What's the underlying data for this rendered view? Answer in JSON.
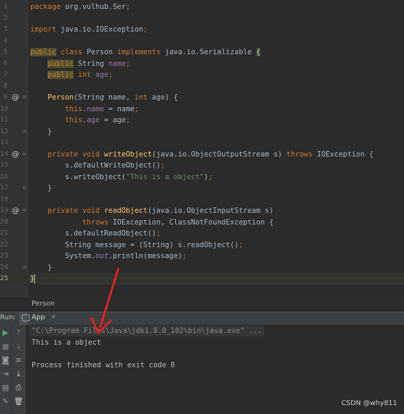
{
  "editor": {
    "lines": [
      {
        "n": "1",
        "ann": "",
        "fold": "",
        "tokens": [
          {
            "t": "package ",
            "c": "#cc7832"
          },
          {
            "t": "org.vulhub.Ser",
            "c": "#a9b7c6"
          },
          {
            "t": ";",
            "c": "#cc7832"
          }
        ]
      },
      {
        "n": "2",
        "ann": "",
        "fold": "",
        "tokens": []
      },
      {
        "n": "3",
        "ann": "",
        "fold": "",
        "tokens": [
          {
            "t": "import ",
            "c": "#cc7832"
          },
          {
            "t": "java.io.IOException",
            "c": "#a9b7c6"
          },
          {
            "t": ";",
            "c": "#cc7832"
          }
        ]
      },
      {
        "n": "4",
        "ann": "",
        "fold": "",
        "tokens": []
      },
      {
        "n": "5",
        "ann": "",
        "fold": "",
        "tokens": [
          {
            "t": "public",
            "c": "#cc7832",
            "bg": "#51502e"
          },
          {
            "t": " class ",
            "c": "#cc7832"
          },
          {
            "t": "Person ",
            "c": "#a9b7c6"
          },
          {
            "t": "implements ",
            "c": "#cc7832"
          },
          {
            "t": "java.io.Serializable ",
            "c": "#a9b7c6"
          },
          {
            "t": "{",
            "c": "#f0d060",
            "bg": "#3b514d"
          }
        ]
      },
      {
        "n": "6",
        "ann": "",
        "fold": "",
        "tokens": [
          {
            "t": "    ",
            "c": "#a9b7c6"
          },
          {
            "t": "public",
            "c": "#cc7832",
            "bg": "#51502e"
          },
          {
            "t": " String ",
            "c": "#a9b7c6"
          },
          {
            "t": "name",
            "c": "#9876aa"
          },
          {
            "t": ";",
            "c": "#cc7832"
          }
        ]
      },
      {
        "n": "7",
        "ann": "",
        "fold": "",
        "tokens": [
          {
            "t": "    ",
            "c": "#a9b7c6"
          },
          {
            "t": "public",
            "c": "#cc7832",
            "bg": "#51502e"
          },
          {
            "t": " int ",
            "c": "#cc7832"
          },
          {
            "t": "age",
            "c": "#9876aa"
          },
          {
            "t": ";",
            "c": "#cc7832"
          }
        ]
      },
      {
        "n": "8",
        "ann": "",
        "fold": "",
        "tokens": []
      },
      {
        "n": "9",
        "ann": "@",
        "fold": "⊖",
        "tokens": [
          {
            "t": "    ",
            "c": "#a9b7c6"
          },
          {
            "t": "Person",
            "c": "#ffc66d"
          },
          {
            "t": "(String name, ",
            "c": "#a9b7c6"
          },
          {
            "t": "int ",
            "c": "#cc7832"
          },
          {
            "t": "age) {",
            "c": "#a9b7c6"
          }
        ]
      },
      {
        "n": "10",
        "ann": "",
        "fold": "",
        "tokens": [
          {
            "t": "        ",
            "c": "#a9b7c6"
          },
          {
            "t": "this",
            "c": "#cc7832"
          },
          {
            "t": ".",
            "c": "#a9b7c6"
          },
          {
            "t": "name",
            "c": "#9876aa"
          },
          {
            "t": " = name",
            "c": "#a9b7c6"
          },
          {
            "t": ";",
            "c": "#cc7832"
          }
        ]
      },
      {
        "n": "11",
        "ann": "",
        "fold": "",
        "tokens": [
          {
            "t": "        ",
            "c": "#a9b7c6"
          },
          {
            "t": "this",
            "c": "#cc7832"
          },
          {
            "t": ".",
            "c": "#a9b7c6"
          },
          {
            "t": "age",
            "c": "#9876aa"
          },
          {
            "t": " = age",
            "c": "#a9b7c6"
          },
          {
            "t": ";",
            "c": "#cc7832"
          }
        ]
      },
      {
        "n": "12",
        "ann": "",
        "fold": "⊖",
        "tokens": [
          {
            "t": "    }",
            "c": "#a9b7c6"
          }
        ]
      },
      {
        "n": "13",
        "ann": "",
        "fold": "",
        "tokens": []
      },
      {
        "n": "14",
        "ann": "@",
        "fold": "⊖",
        "tokens": [
          {
            "t": "    ",
            "c": "#a9b7c6"
          },
          {
            "t": "private void ",
            "c": "#cc7832"
          },
          {
            "t": "writeObject",
            "c": "#ffc66d"
          },
          {
            "t": "(java.io.ObjectOutputStream s) ",
            "c": "#a9b7c6"
          },
          {
            "t": "throws ",
            "c": "#cc7832"
          },
          {
            "t": "IOException {",
            "c": "#a9b7c6"
          }
        ]
      },
      {
        "n": "15",
        "ann": "",
        "fold": "",
        "tokens": [
          {
            "t": "        s.defaultWriteObject()",
            "c": "#a9b7c6"
          },
          {
            "t": ";",
            "c": "#cc7832"
          }
        ]
      },
      {
        "n": "16",
        "ann": "",
        "fold": "",
        "tokens": [
          {
            "t": "        s.writeObject(",
            "c": "#a9b7c6"
          },
          {
            "t": "\"This is a object\"",
            "c": "#6a8759"
          },
          {
            "t": ")",
            "c": "#a9b7c6"
          },
          {
            "t": ";",
            "c": "#cc7832"
          }
        ]
      },
      {
        "n": "17",
        "ann": "",
        "fold": "⊖",
        "tokens": [
          {
            "t": "    }",
            "c": "#a9b7c6"
          }
        ]
      },
      {
        "n": "18",
        "ann": "",
        "fold": "",
        "tokens": []
      },
      {
        "n": "19",
        "ann": "@",
        "fold": "⊖",
        "tokens": [
          {
            "t": "    ",
            "c": "#a9b7c6"
          },
          {
            "t": "private void ",
            "c": "#cc7832"
          },
          {
            "t": "readObject",
            "c": "#ffc66d"
          },
          {
            "t": "(java.io.ObjectInputStream s)",
            "c": "#a9b7c6"
          }
        ]
      },
      {
        "n": "20",
        "ann": "",
        "fold": "",
        "tokens": [
          {
            "t": "            ",
            "c": "#a9b7c6"
          },
          {
            "t": "throws ",
            "c": "#cc7832"
          },
          {
            "t": "IOException, ClassNotFoundException {",
            "c": "#a9b7c6"
          }
        ]
      },
      {
        "n": "21",
        "ann": "",
        "fold": "",
        "tokens": [
          {
            "t": "        s.defaultReadObject()",
            "c": "#a9b7c6"
          },
          {
            "t": ";",
            "c": "#cc7832"
          }
        ]
      },
      {
        "n": "22",
        "ann": "",
        "fold": "",
        "tokens": [
          {
            "t": "        String message = (String) s.readObject()",
            "c": "#a9b7c6"
          },
          {
            "t": ";",
            "c": "#cc7832"
          }
        ]
      },
      {
        "n": "23",
        "ann": "",
        "fold": "",
        "tokens": [
          {
            "t": "        System.",
            "c": "#a9b7c6"
          },
          {
            "t": "out",
            "c": "#9876aa",
            "i": true
          },
          {
            "t": ".println(message)",
            "c": "#a9b7c6"
          },
          {
            "t": ";",
            "c": "#cc7832"
          }
        ]
      },
      {
        "n": "24",
        "ann": "",
        "fold": "⊖",
        "tokens": [
          {
            "t": "    }",
            "c": "#a9b7c6"
          }
        ]
      },
      {
        "n": "25",
        "ann": "",
        "fold": "",
        "active": true,
        "tokens": [
          {
            "t": "}",
            "c": "#f0d060",
            "bg": "#3b514d"
          }
        ]
      }
    ]
  },
  "breadcrumb": {
    "item": "Person"
  },
  "run_panel": {
    "label": "Run:",
    "tab_label": "App",
    "tab_close": "×",
    "output": [
      {
        "text": "\"C:\\Program Files\\Java\\jdk1.8.0_102\\bin\\java.exe\" ...",
        "color": "#8c8c8c",
        "bg": "#343638"
      },
      {
        "text": "This is a object",
        "color": "#bbbbbb"
      },
      {
        "text": "",
        "color": "#bbbbbb"
      },
      {
        "text": "Process finished with exit code 0",
        "color": "#bbbbbb"
      }
    ],
    "toolbar_left": [
      {
        "name": "rerun-icon",
        "glyph": "▶",
        "color": "#59a869"
      },
      {
        "name": "stop-icon",
        "glyph": "■",
        "color": "#6b6b6b"
      },
      {
        "name": "camera-icon",
        "glyph": "◙",
        "color": "#9a9a9a"
      },
      {
        "name": "login-icon",
        "glyph": "⇥",
        "color": "#9a9a9a"
      },
      {
        "name": "layout-icon",
        "glyph": "▤",
        "color": "#9a9a9a"
      },
      {
        "name": "pin-icon",
        "glyph": "✎",
        "color": "#9a9a9a"
      }
    ],
    "toolbar_right": [
      {
        "name": "scroll-up-icon",
        "glyph": "↑",
        "color": "#6b6b6b"
      },
      {
        "name": "scroll-down-icon",
        "glyph": "↓",
        "color": "#6b6b6b"
      },
      {
        "name": "soft-wrap-icon",
        "glyph": "≡",
        "color": "#9a9a9a"
      },
      {
        "name": "scroll-to-end-icon",
        "glyph": "⤓",
        "color": "#cfcfcf"
      },
      {
        "name": "print-icon",
        "glyph": "⎙",
        "color": "#cfcfcf"
      },
      {
        "name": "trash-icon",
        "glyph": "🗑",
        "color": "#cfcfcf"
      }
    ]
  },
  "watermark": "CSDN @why811",
  "colors": {
    "arrow": "#e0241b",
    "background": "#2b2b2b",
    "panel": "#3c3f41"
  }
}
